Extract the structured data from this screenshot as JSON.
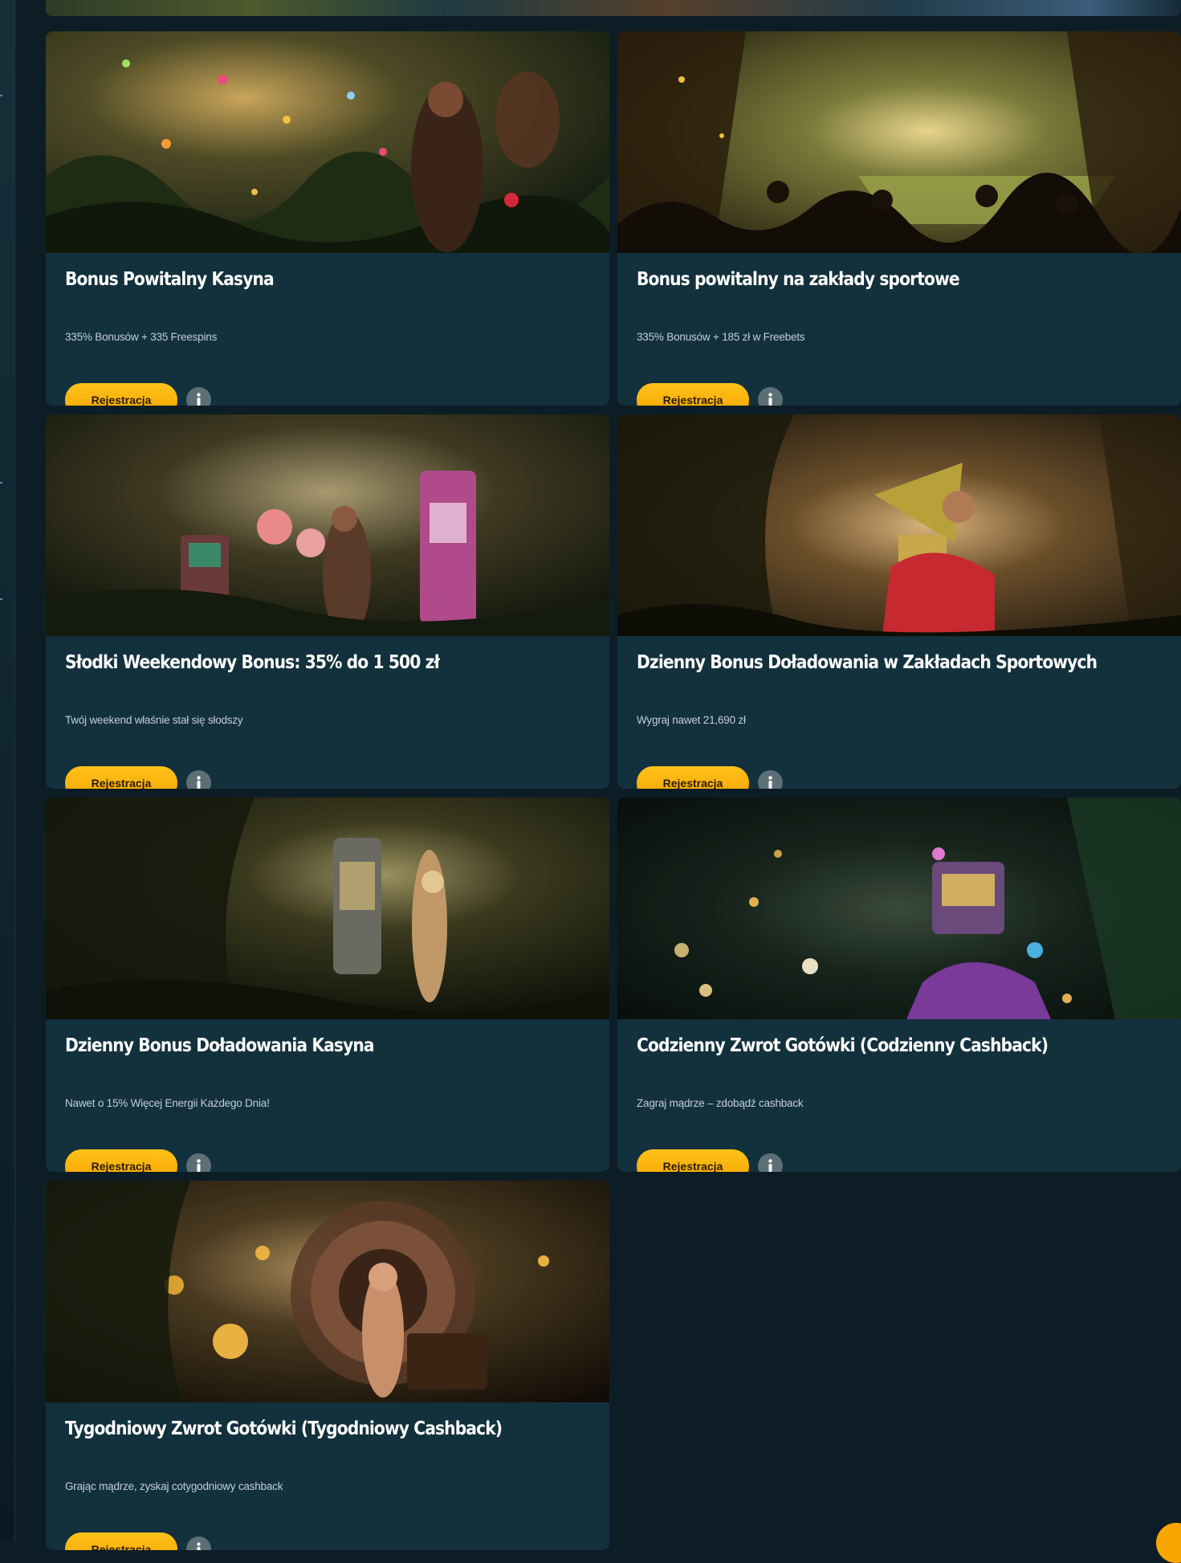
{
  "promotions": [
    {
      "title": "Bonus Powitalny Kasyna",
      "subtitle": "335% Bonusów + 335 Freespins",
      "cta": "Rejestracja",
      "scene": "casino-welcome"
    },
    {
      "title": "Bonus powitalny na zakłady sportowe",
      "subtitle": "335% Bonusów + 185 zł w Freebets",
      "cta": "Rejestracja",
      "scene": "stadium"
    },
    {
      "title": "Słodki Weekendowy Bonus: 35% do 1 500 zł",
      "subtitle": "Twój weekend właśnie stał się słodszy",
      "cta": "Rejestracja",
      "scene": "candy-slots"
    },
    {
      "title": "Dzienny Bonus Doładowania w Zakładach Sportowych",
      "subtitle": "Wygraj nawet 21,690 zł",
      "cta": "Rejestracja",
      "scene": "trophy"
    },
    {
      "title": "Dzienny Bonus Doładowania Kasyna",
      "subtitle": "Nawet o 15% Więcej Energii Każdego Dnia!",
      "cta": "Rejestracja",
      "scene": "slot-machine"
    },
    {
      "title": "Codzienny Zwrot Gotówki (Codzienny Cashback)",
      "subtitle": "Zagraj mądrze – zdobądź cashback",
      "cta": "Rejestracja",
      "scene": "treasure"
    },
    {
      "title": "Tygodniowy Zwrot Gotówki (Tygodniowy Cashback)",
      "subtitle": "Grając mądrze, zyskaj cotygodniowy cashback",
      "cta": "Rejestracja",
      "scene": "roulette"
    }
  ],
  "colors": {
    "page_bg": "#0d1d26",
    "card_bg": "#13303d",
    "accent": "#f7a600",
    "info_icon_bg": "#5c6f77"
  }
}
